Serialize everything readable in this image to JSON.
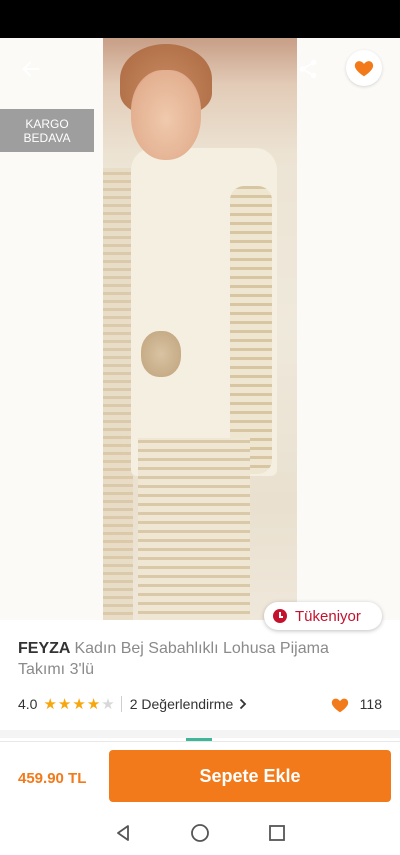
{
  "badges": {
    "cargo_line1": "KARGO",
    "cargo_line2": "BEDAVA",
    "stock": "Tükeniyor"
  },
  "gallery": {
    "dots": 4,
    "active_index": 2
  },
  "product": {
    "brand": "FEYZA",
    "name": "Kadın Bej Sabahlıklı Lohusa  Pijama Takımı 3'lü",
    "rating": "4.0",
    "rating_value": 4,
    "rating_max": 5,
    "reviews_text": "2 Değerlendirme",
    "favorites": "118"
  },
  "purchase": {
    "price": "459.90 TL",
    "add_to_cart": "Sepete Ekle"
  },
  "icons": {
    "back": "arrow-left-icon",
    "share": "share-icon",
    "favorite": "heart-icon",
    "stock": "clock-icon",
    "nav": [
      "back-triangle-icon",
      "home-circle-icon",
      "recents-square-icon"
    ]
  },
  "colors": {
    "accent": "#f27a1a",
    "stock_red": "#c4122e",
    "star": "#f7a70e",
    "badge_gray": "#9e9e9e"
  }
}
